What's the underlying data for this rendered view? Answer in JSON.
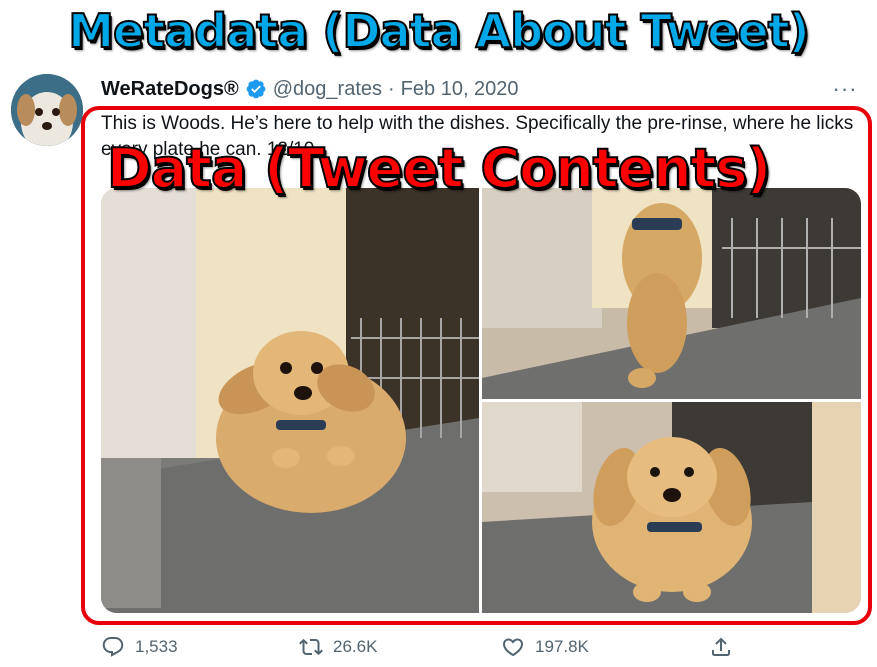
{
  "overlay": {
    "metadata_caption": "Metadata (Data About Tweet)",
    "data_caption": "Data (Tweet Contents)"
  },
  "tweet": {
    "display_name": "WeRateDogs®",
    "handle": "@dog_rates",
    "separator": "·",
    "date": "Feb 10, 2020",
    "more_label": "···",
    "text": "This is Woods. He’s here to help with the dishes. Specifically the pre-rinse, where he licks every plate he can. 12/10"
  },
  "actions": {
    "replies": "1,533",
    "retweets": "26.6K",
    "likes": "197.8K"
  },
  "icons": [
    "verified-badge-icon",
    "more-icon",
    "reply-icon",
    "retweet-icon",
    "like-icon",
    "share-icon"
  ],
  "colors": {
    "metadata_caption": "#00a8e8",
    "data_caption": "#ff0000",
    "highlight_box": "#e8000b",
    "verified": "#1d9bf0",
    "secondary_text": "#536471",
    "primary_text": "#0f1419"
  }
}
